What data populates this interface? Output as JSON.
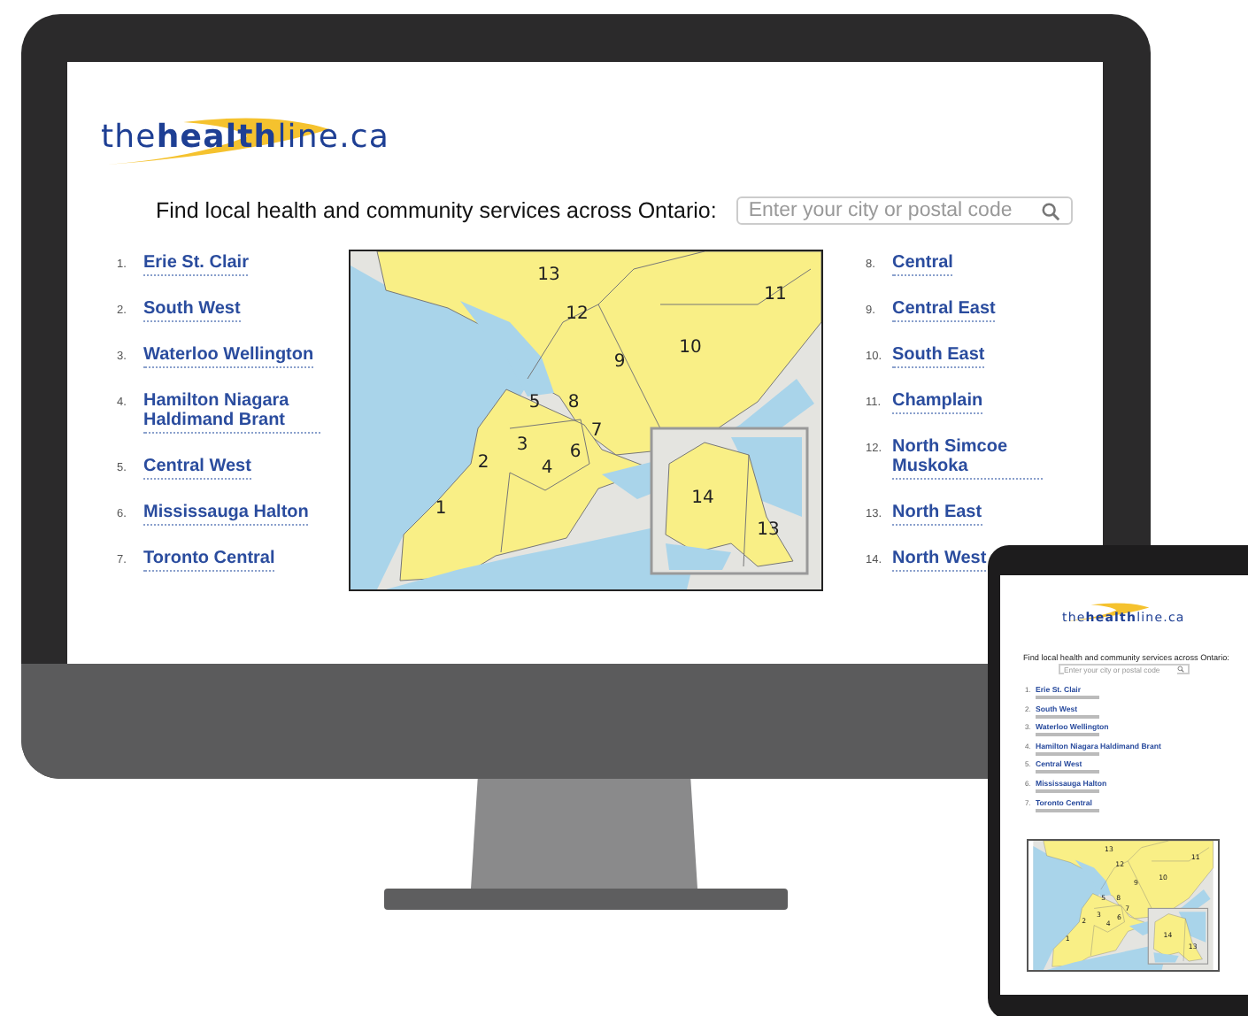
{
  "desktop": {
    "logo": "the**health**line.ca",
    "prompt": "Find local health and community services across Ontario:",
    "search": {
      "placeholder": "Enter your city or postal code"
    },
    "left_regions": [
      {
        "number": "1.",
        "name": "Erie St. Clair"
      },
      {
        "number": "2.",
        "name": "South West"
      },
      {
        "number": "3.",
        "name": "Waterloo Wellington"
      },
      {
        "number": "4.",
        "name": "Hamilton Niagara Haldimand Brant"
      },
      {
        "number": "5.",
        "name": "Central West"
      },
      {
        "number": "6.",
        "name": "Mississauga Halton"
      },
      {
        "number": "7.",
        "name": "Toronto Central"
      }
    ],
    "map_labels": [
      "13",
      "12",
      "11",
      "10",
      "9",
      "5",
      "8",
      "3",
      "7",
      "6",
      "2",
      "4",
      "1",
      "14",
      "13"
    ],
    "right_regions": [
      {
        "number": "8.",
        "name": "Central"
      },
      {
        "number": "9.",
        "name": "Central East"
      },
      {
        "number": "10.",
        "name": "South East"
      },
      {
        "number": "11.",
        "name": "Champlain"
      },
      {
        "number": "12.",
        "name": "North Simcoe Muskoka"
      },
      {
        "number": "13.",
        "name": "North East"
      },
      {
        "number": "14.",
        "name": "North West"
      }
    ]
  },
  "tablet": {
    "logo": "the**health**line.ca",
    "prompt": "Find local health and community services across Ontario:",
    "search": {
      "placeholder": "Enter your city or postal code"
    },
    "regions": [
      {
        "number": "1.",
        "name": "Erie St. Clair"
      },
      {
        "number": "2.",
        "name": "South West"
      },
      {
        "number": "3.",
        "name": "Waterloo Wellington"
      },
      {
        "number": "4.",
        "name": "Hamilton Niagara Haldimand Brant"
      },
      {
        "number": "5.",
        "name": "Central West"
      },
      {
        "number": "6.",
        "name": "Mississauga Halton"
      },
      {
        "number": "7.",
        "name": "Toronto Central"
      }
    ],
    "map_labels": [
      "13",
      "12",
      "11",
      "10",
      "9",
      "5",
      "8",
      "3",
      "7",
      "6",
      "2",
      "4",
      "1",
      "14",
      "13"
    ]
  }
}
